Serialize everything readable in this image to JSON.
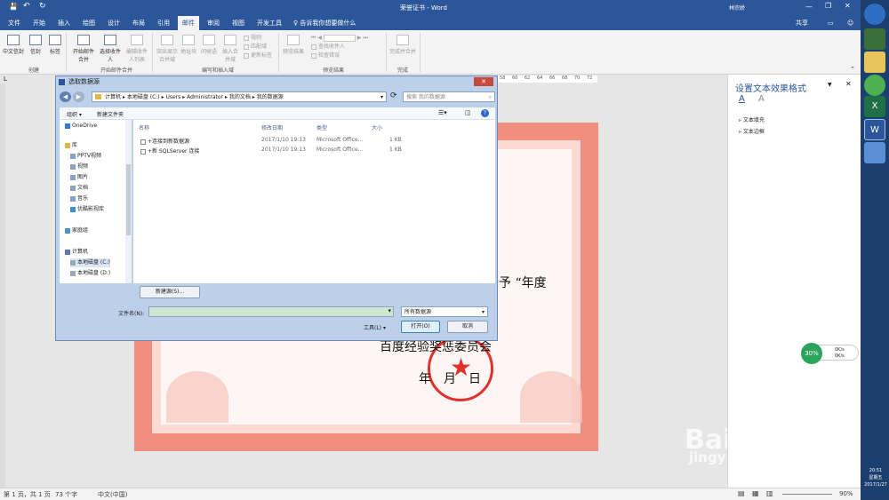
{
  "window": {
    "title": "荣誉证书 - Word",
    "user": "林宗娇"
  },
  "quick_access": {
    "save": "💾",
    "undo": "↶",
    "redo": "↻"
  },
  "tabs": [
    "文件",
    "开始",
    "插入",
    "绘图",
    "设计",
    "布局",
    "引用",
    "邮件",
    "审阅",
    "视图",
    "开发工具"
  ],
  "tell_me": "告诉我你想要做什么",
  "share": "共享",
  "ribbon": {
    "create": {
      "envelope": "中文信封",
      "envelopes": "信封",
      "labels": "标签",
      "group": "创建"
    },
    "start": {
      "start": "开始邮件合并",
      "select": "选择收件人",
      "edit": "编辑收件人列表",
      "group": "开始邮件合并"
    },
    "write": {
      "highlight": "突出显示合并域",
      "address": "地址块",
      "greeting": "问候语",
      "insert": "插入合并域",
      "rules": "规则",
      "match": "匹配域",
      "update": "更新标签",
      "group": "编写和插入域"
    },
    "preview": {
      "preview": "预览结果",
      "find": "查找收件人",
      "check": "检查错误",
      "group": "预览结果"
    },
    "finish": {
      "finish": "完成并合并",
      "group": "完成"
    }
  },
  "ruler_numbers": [
    "58",
    "60",
    "62",
    "64",
    "66",
    "68",
    "70",
    "72"
  ],
  "dialog": {
    "title": "选取数据源",
    "path": [
      "计算机",
      "本地磁盘 (C:)",
      "Users",
      "Administrator",
      "我的文档",
      "我的数据源"
    ],
    "search_placeholder": "搜索 我的数据源",
    "organize": "组织 ▾",
    "new_folder": "新建文件夹",
    "nav": [
      "OneDrive",
      "库",
      "PPTV视频",
      "视频",
      "图片",
      "文档",
      "音乐",
      "优酷影视库",
      "家庭组",
      "计算机",
      "本地磁盘 (C:)",
      "本地磁盘 (D:)"
    ],
    "columns": [
      "名称",
      "修改日期",
      "类型",
      "大小"
    ],
    "files": [
      {
        "name": "+连接到新数据源",
        "date": "2017/1/10 19:13",
        "type": "Microsoft Office...",
        "size": "1 KB"
      },
      {
        "name": "+新 SQLServer 连接",
        "date": "2017/1/10 19:13",
        "type": "Microsoft Office...",
        "size": "1 KB"
      }
    ],
    "new_source": "新建源(S)...",
    "filename_label": "文件名(N):",
    "filetype": "所有数据源",
    "tools": "工具(L)",
    "open": "打开(O)",
    "cancel": "取消"
  },
  "certificate": {
    "text1": "予 “年度",
    "text2": "百度经验奖惩委员会",
    "text3": "年　月　日"
  },
  "pane": {
    "title": "设置文本效果格式",
    "fill": "文本填充",
    "outline": "文本边框"
  },
  "status": {
    "page": "第 1 页，共 1 页",
    "words": "73 个字",
    "lang": "中文(中国)",
    "zoom": "90%"
  },
  "tray": {
    "percent": "30%",
    "up": "0K/s",
    "down": "0K/s",
    "time": "20:51",
    "day": "星期五",
    "date": "2017/1/27"
  },
  "watermark": {
    "brand": "Bai du 经验",
    "url": "jingyan.baidu.com"
  }
}
